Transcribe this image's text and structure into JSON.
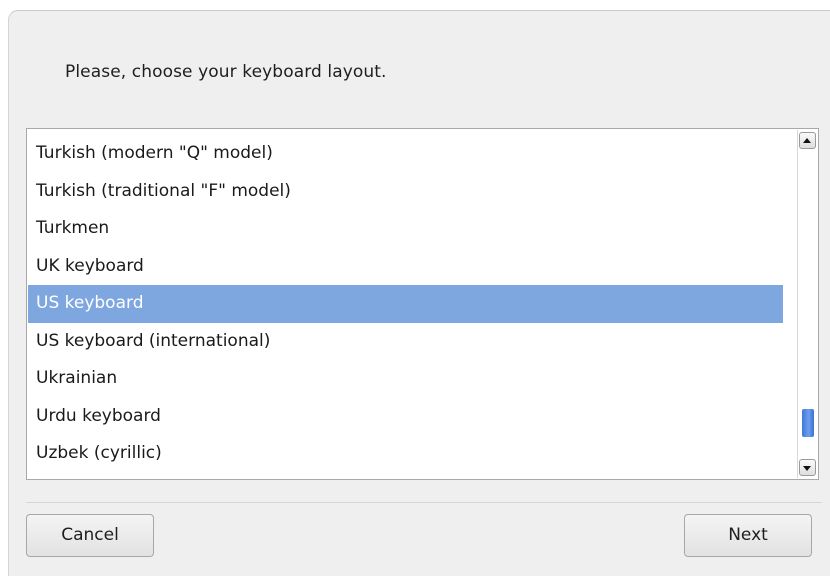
{
  "dialog": {
    "prompt": "Please, choose your keyboard layout."
  },
  "layouts": {
    "items": [
      {
        "label": "Turkish (modern \"Q\" model)",
        "selected": false
      },
      {
        "label": "Turkish (traditional \"F\" model)",
        "selected": false
      },
      {
        "label": "Turkmen",
        "selected": false
      },
      {
        "label": "UK keyboard",
        "selected": false
      },
      {
        "label": "US keyboard",
        "selected": true
      },
      {
        "label": "US keyboard (international)",
        "selected": false
      },
      {
        "label": "Ukrainian",
        "selected": false
      },
      {
        "label": "Urdu keyboard",
        "selected": false
      },
      {
        "label": "Uzbek (cyrillic)",
        "selected": false
      }
    ],
    "scroll_position": 0.95,
    "selection_color": "#7ea7e0",
    "scroll_up_icon": "triangle-up-icon",
    "scroll_down_icon": "triangle-down-icon"
  },
  "buttons": {
    "cancel_label": "Cancel",
    "next_label": "Next"
  }
}
